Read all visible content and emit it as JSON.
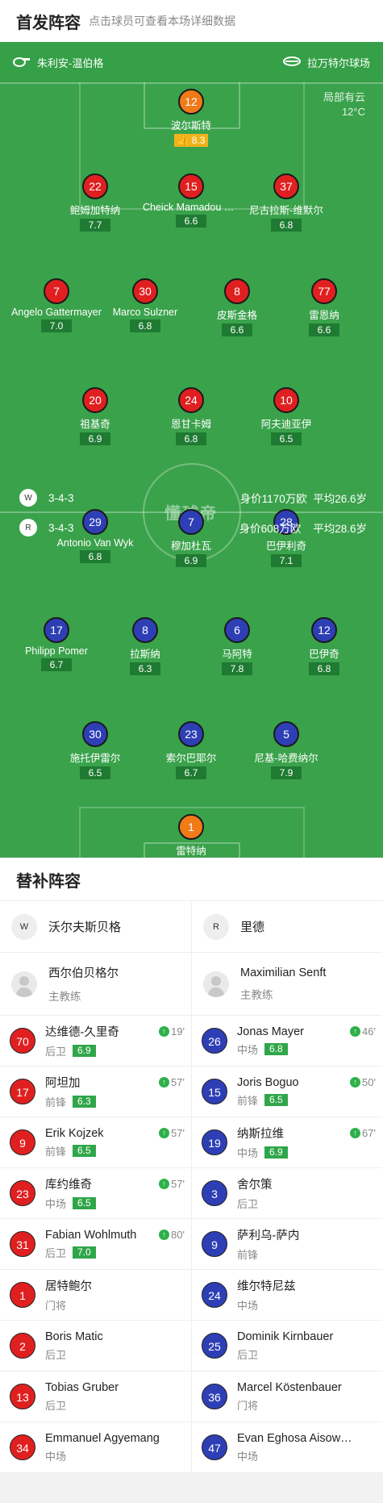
{
  "header": {
    "title": "首发阵容",
    "hint": "点击球员可查看本场详细数据"
  },
  "info": {
    "referee": "朱利安-温伯格",
    "stadium": "拉万特尔球场"
  },
  "weather": {
    "condition": "局部有云",
    "temp": "12°C"
  },
  "watermark": "懂球帝",
  "home": {
    "formation": "3-4-3",
    "value": "身价1170万欧",
    "avg_age": "平均26.6岁",
    "players": [
      {
        "num": "12",
        "name": "波尔斯特",
        "rating": "8.3",
        "color": "orange",
        "best": true
      },
      {
        "num": "22",
        "name": "鲍姆加特纳",
        "rating": "7.7",
        "color": "red",
        "captain": true
      },
      {
        "num": "15",
        "name": "Cheick Mamadou Diabate",
        "rating": "6.6",
        "color": "red"
      },
      {
        "num": "37",
        "name": "尼古拉斯-维默尔",
        "rating": "6.8",
        "color": "red"
      },
      {
        "num": "7",
        "name": "Angelo Gattermayer",
        "rating": "7.0",
        "color": "red"
      },
      {
        "num": "30",
        "name": "Marco Sulzner",
        "rating": "6.8",
        "color": "red",
        "sub_min": "57'"
      },
      {
        "num": "8",
        "name": "皮斯金格",
        "rating": "6.6",
        "color": "red"
      },
      {
        "num": "77",
        "name": "雷恩纳",
        "rating": "6.6",
        "color": "red",
        "sub_min": "19'"
      },
      {
        "num": "20",
        "name": "祖基奇",
        "rating": "6.9",
        "color": "red",
        "sub_min": "80'"
      },
      {
        "num": "24",
        "name": "恩甘卡姆",
        "rating": "6.8",
        "color": "red",
        "sub_min": "57'"
      },
      {
        "num": "10",
        "name": "阿夫迪亚伊",
        "rating": "6.5",
        "color": "red",
        "sub_min": "57'"
      }
    ]
  },
  "away": {
    "formation": "3-4-3",
    "value": "身价608万欧",
    "avg_age": "平均28.6岁",
    "players": [
      {
        "num": "29",
        "name": "Antonio Van Wyk",
        "rating": "6.8",
        "color": "blue",
        "sub_min": "50'"
      },
      {
        "num": "7",
        "name": "穆加杜瓦",
        "rating": "6.9",
        "color": "blue"
      },
      {
        "num": "28",
        "name": "巴伊利奇",
        "rating": "7.1",
        "color": "blue",
        "sub_min": "67'"
      },
      {
        "num": "17",
        "name": "Philipp Pomer",
        "rating": "6.7",
        "color": "blue",
        "yellow": true
      },
      {
        "num": "8",
        "name": "拉斯纳",
        "rating": "6.3",
        "color": "blue",
        "yellow": true,
        "sub_min": "46'"
      },
      {
        "num": "6",
        "name": "马阿特",
        "rating": "7.8",
        "color": "blue"
      },
      {
        "num": "12",
        "name": "巴伊奇",
        "rating": "6.8",
        "color": "blue"
      },
      {
        "num": "30",
        "name": "施托伊雷尔",
        "rating": "6.5",
        "color": "blue"
      },
      {
        "num": "23",
        "name": "索尔巴耶尔",
        "rating": "6.7",
        "color": "blue"
      },
      {
        "num": "5",
        "name": "尼基-哈费纳尔",
        "rating": "7.9",
        "color": "blue"
      },
      {
        "num": "1",
        "name": "雷特纳",
        "rating": "7.5",
        "color": "orange",
        "captain": true
      }
    ]
  },
  "subs": {
    "title": "替补阵容",
    "home_team": "沃尔夫斯贝格",
    "away_team": "里德",
    "home_coach": "西尔伯贝格尔",
    "away_coach": "Maximilian Senft",
    "coach_label": "主教练",
    "home_list": [
      {
        "num": "70",
        "name": "达维德-久里奇",
        "pos": "后卫",
        "rating": "6.9",
        "min": "19'"
      },
      {
        "num": "17",
        "name": "阿坦加",
        "pos": "前锋",
        "rating": "6.3",
        "min": "57'"
      },
      {
        "num": "9",
        "name": "Erik Kojzek",
        "pos": "前锋",
        "rating": "6.5",
        "min": "57'"
      },
      {
        "num": "23",
        "name": "库约维奇",
        "pos": "中场",
        "rating": "6.5",
        "min": "57'"
      },
      {
        "num": "31",
        "name": "Fabian Wohlmuth",
        "pos": "后卫",
        "rating": "7.0",
        "min": "80'"
      },
      {
        "num": "1",
        "name": "居特鲍尔",
        "pos": "门将"
      },
      {
        "num": "2",
        "name": "Boris Matic",
        "pos": "后卫"
      },
      {
        "num": "13",
        "name": "Tobias Gruber",
        "pos": "后卫"
      },
      {
        "num": "34",
        "name": "Emmanuel Agyemang",
        "pos": "中场"
      }
    ],
    "away_list": [
      {
        "num": "26",
        "name": "Jonas Mayer",
        "pos": "中场",
        "rating": "6.8",
        "min": "46'"
      },
      {
        "num": "15",
        "name": "Joris Boguo",
        "pos": "前锋",
        "rating": "6.5",
        "min": "50'"
      },
      {
        "num": "19",
        "name": "纳斯拉维",
        "pos": "中场",
        "rating": "6.9",
        "min": "67'"
      },
      {
        "num": "3",
        "name": "舍尔策",
        "pos": "后卫"
      },
      {
        "num": "9",
        "name": "萨利乌-萨内",
        "pos": "前锋"
      },
      {
        "num": "24",
        "name": "维尔特尼兹",
        "pos": "中场"
      },
      {
        "num": "25",
        "name": "Dominik Kirnbauer",
        "pos": "后卫"
      },
      {
        "num": "36",
        "name": "Marcel Köstenbauer",
        "pos": "门将"
      },
      {
        "num": "47",
        "name": "Evan Eghosa Aisowieren",
        "pos": "中场"
      }
    ]
  }
}
